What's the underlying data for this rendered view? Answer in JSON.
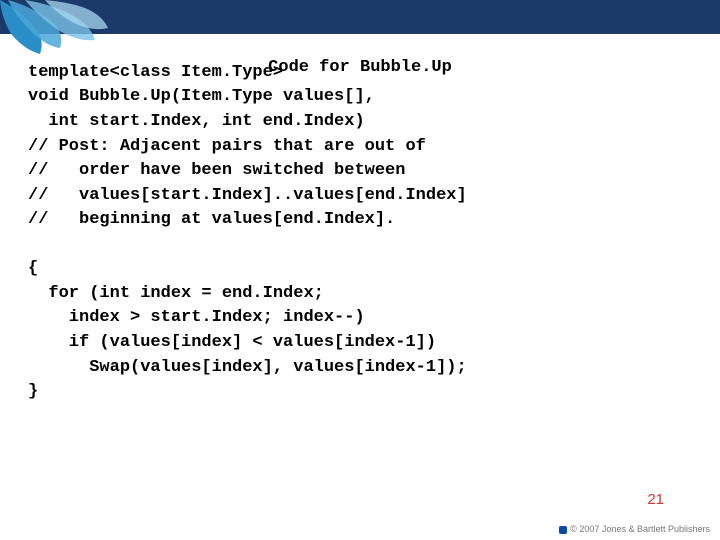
{
  "title": "Code for Bubble.Up",
  "code_block1": "template<class Item.Type>\nvoid Bubble.Up(Item.Type values[],\n  int start.Index, int end.Index)\n// Post: Adjacent pairs that are out of\n//   order have been switched between\n//   values[start.Index]..values[end.Index]\n//   beginning at values[end.Index].",
  "code_block2": "{\n  for (int index = end.Index;\n    index > start.Index; index--)\n    if (values[index] < values[index-1])\n      Swap(values[index], values[index-1]);\n}",
  "page_number": "21",
  "copyright": "© 2007 Jones & Bartlett Publishers"
}
